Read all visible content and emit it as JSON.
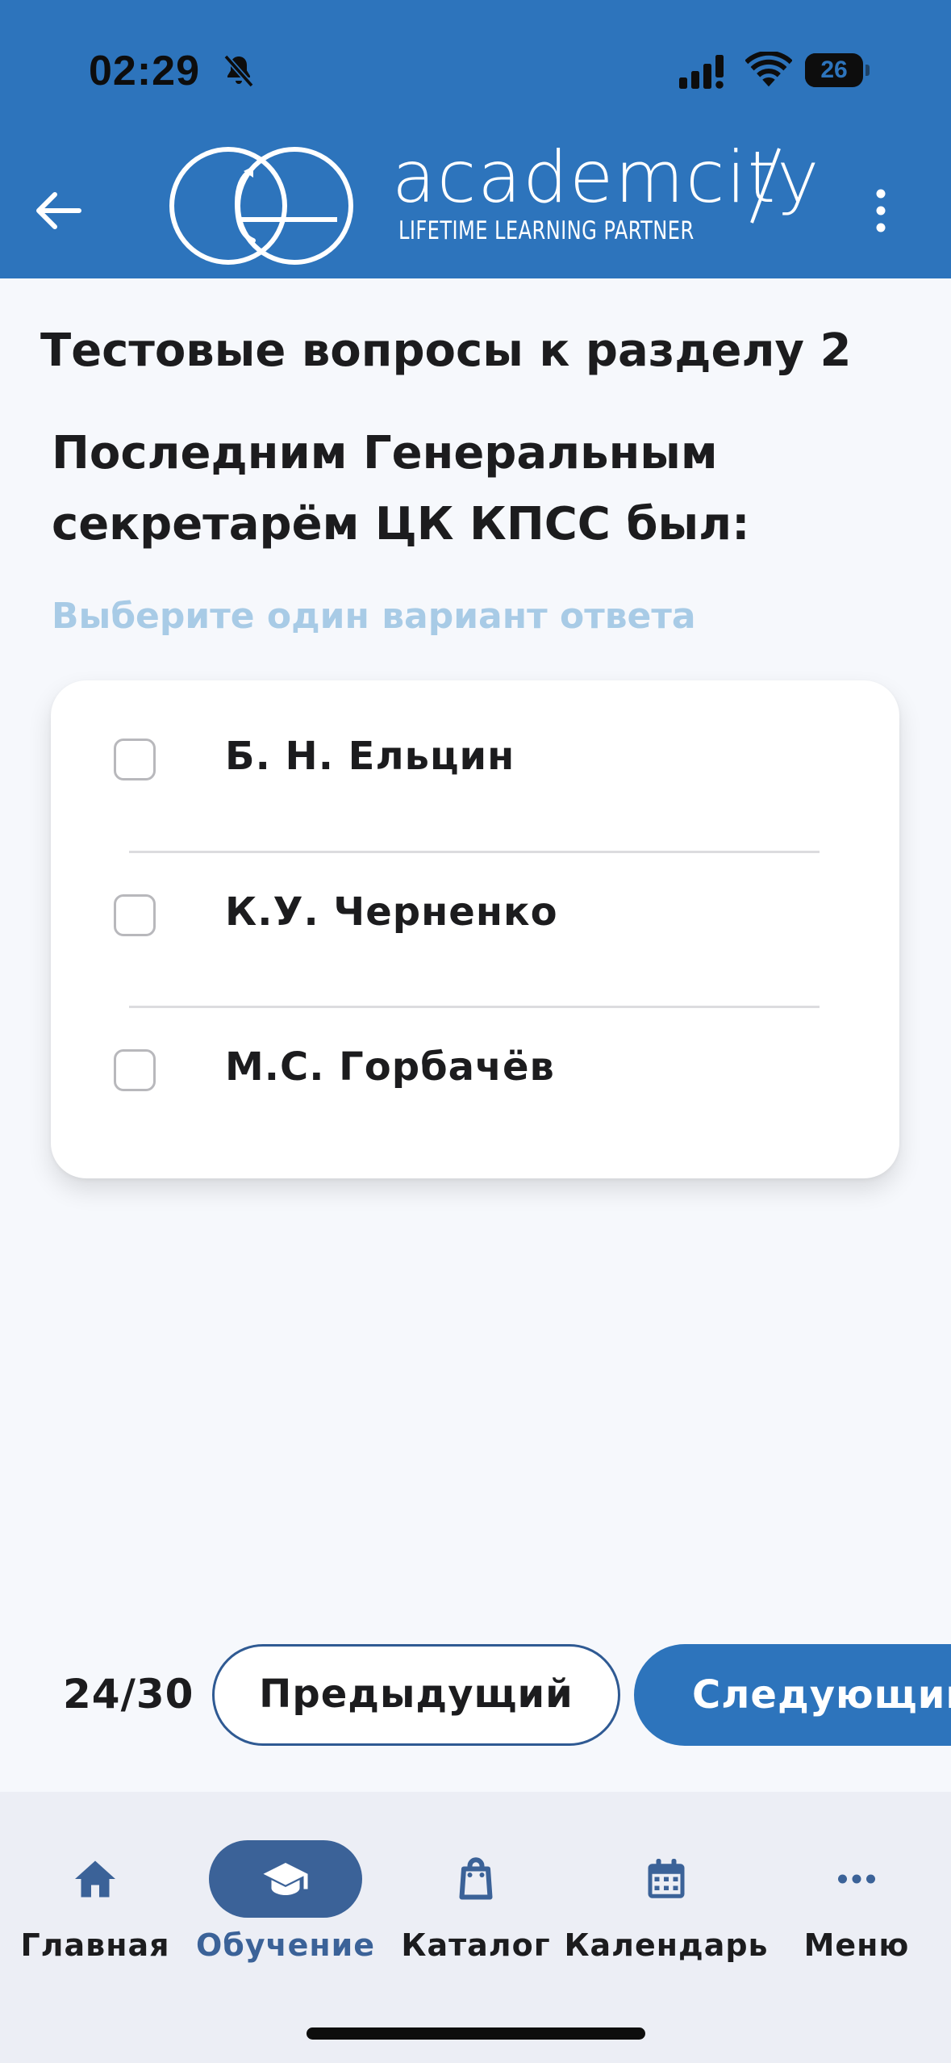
{
  "status_bar": {
    "time": "02:29",
    "battery_level": "26",
    "icons": [
      "bell-off-icon",
      "signal-icon",
      "wifi-icon",
      "battery-icon"
    ]
  },
  "header": {
    "brand_name": "academcity",
    "tagline": "LIFETIME LEARNING PARTNER",
    "back_icon": "arrow-left-icon",
    "more_icon": "more-vertical-icon"
  },
  "quiz": {
    "section_title": "Тестовые вопросы к разделу 2",
    "question_line1": "Последним Генеральным",
    "question_line2": "секретарём ЦК КПСС был:",
    "hint": "Выберите один вариант ответа",
    "options": [
      {
        "label": "Б. Н. Ельцин",
        "checked": false
      },
      {
        "label": "К.У. Черненко",
        "checked": false
      },
      {
        "label": "М.С. Горбачёв",
        "checked": false
      }
    ]
  },
  "pager": {
    "counter": "24/30",
    "prev_label": "Предыдущий",
    "next_label": "Следующий"
  },
  "tabbar": {
    "active": "Обучение",
    "items": [
      {
        "label": "Главная",
        "icon": "home-icon"
      },
      {
        "label": "Обучение",
        "icon": "graduation-cap-icon"
      },
      {
        "label": "Каталог",
        "icon": "shopping-bag-icon"
      },
      {
        "label": "Календарь",
        "icon": "calendar-icon"
      },
      {
        "label": "Меню",
        "icon": "more-horizontal-icon"
      }
    ]
  },
  "colors": {
    "brand_blue": "#2d74bc",
    "active_tab": "#3b6298",
    "hint": "#a8cbe6"
  }
}
